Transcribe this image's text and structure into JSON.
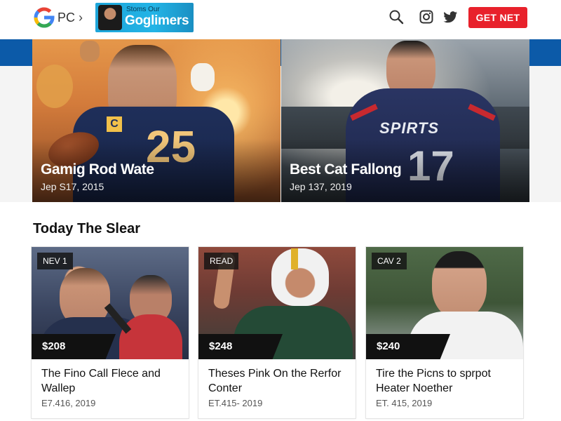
{
  "header": {
    "breadcrumb": "PC",
    "breadcrumb_chevron": "›",
    "promo": {
      "subtitle": "Stoms Our",
      "title": "Goglimers"
    },
    "icons": [
      "search-icon",
      "instagram-icon",
      "twitter-icon"
    ],
    "cta_label": "GET NET",
    "colors": {
      "cta": "#e8212b",
      "strip": "#0c5aa8",
      "promo": "#1ea5d9"
    }
  },
  "hero": [
    {
      "title": "Gamig Rod Wate",
      "date": "Jep S17, 2015",
      "jersey_number": "25",
      "captain_patch": "C"
    },
    {
      "title": "Best Cat Fallong",
      "date": "Jep 137, 2019",
      "jersey_text": "SPIRTS",
      "jersey_number": "17"
    }
  ],
  "section": {
    "title": "Today The Slear"
  },
  "cards": [
    {
      "tag": "NEV 1",
      "price": "$208",
      "title": "The Fino Call Flece and Wallep",
      "date": "E7.416, 2019"
    },
    {
      "tag": "READ",
      "price": "$248",
      "title": "Theses Pink On the Rerfor Conter",
      "date": "ET.415- 2019"
    },
    {
      "tag": "CAV 2",
      "price": "$240",
      "title": "Tire the Picns to sprpot Heater Noether",
      "date": "ET. 415, 2019"
    }
  ]
}
